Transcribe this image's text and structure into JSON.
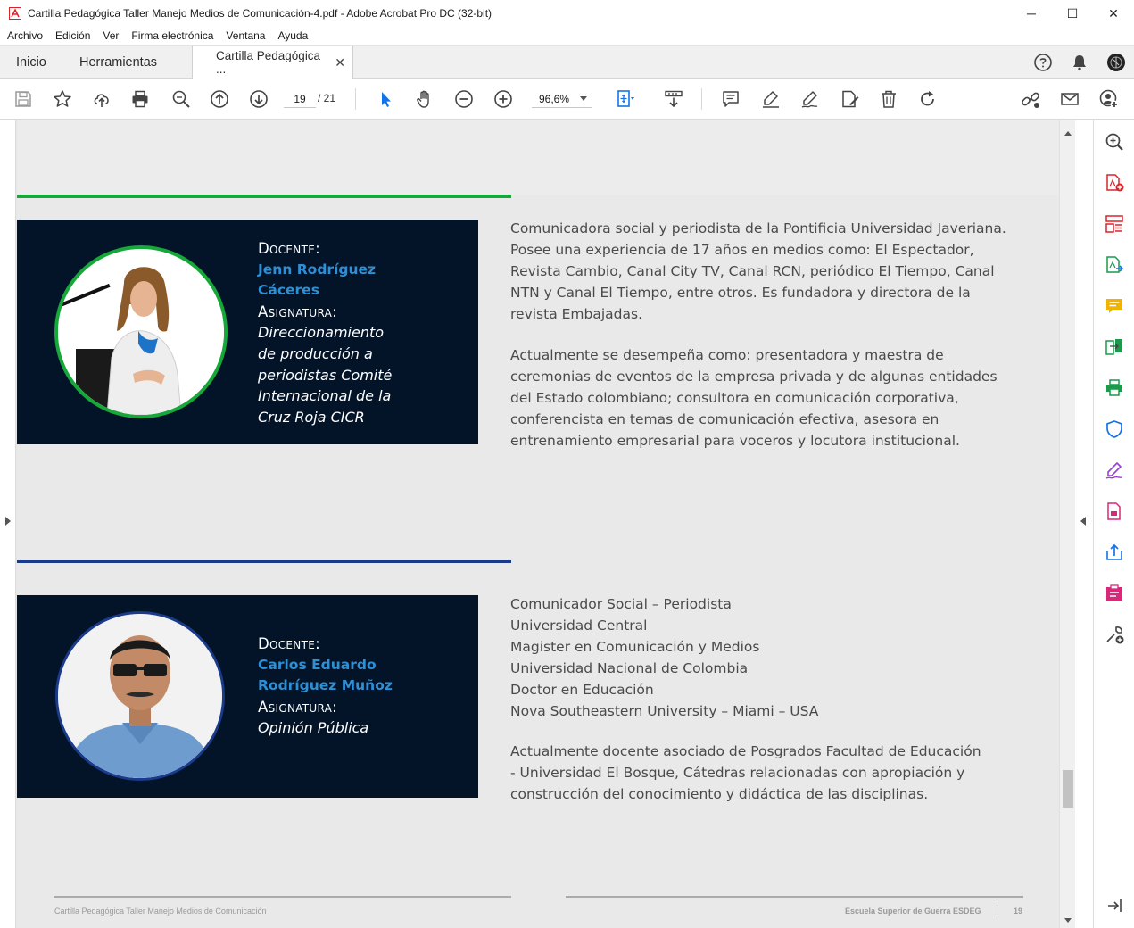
{
  "window": {
    "title": "Cartilla Pedagógica Taller Manejo Medios de Comunicación-4.pdf - Adobe Acrobat Pro DC (32-bit)",
    "controls": {
      "minimize": "─",
      "maximize": "☐",
      "close": "✕"
    }
  },
  "menu": [
    "Archivo",
    "Edición",
    "Ver",
    "Firma electrónica",
    "Ventana",
    "Ayuda"
  ],
  "tabs": [
    {
      "label": "Inicio"
    },
    {
      "label": "Herramientas"
    },
    {
      "label": "Cartilla Pedagógica ...",
      "close": "✕"
    }
  ],
  "toolbar": {
    "current_page": "19",
    "total_pages": "/ 21",
    "zoom": "96,6%"
  },
  "document": {
    "person1": {
      "docente_label": "Docente:",
      "name_line1": "Jenn Rodríguez",
      "name_line2": "Cáceres",
      "asignatura_label": "Asignatura:",
      "subject_lines": [
        "Direccionamiento",
        "de producción a",
        "periodistas Comité",
        "Internacional de la",
        "Cruz Roja CICR"
      ],
      "bio_p1": "Comunicadora social y periodista de la Pontificia Universidad Javeriana.\nPosee una experiencia de 17 años en medios como: El Espectador,\nRevista Cambio, Canal City TV, Canal RCN, periódico El Tiempo, Canal\nNTN y Canal El Tiempo, entre otros.  Es fundadora y directora de la\nrevista Embajadas.",
      "bio_p2": "Actualmente se desempeña como: presentadora y maestra de\nceremonias de eventos de la empresa privada y de algunas entidades\ndel Estado colombiano; consultora en comunicación corporativa,\nconferencista en temas de comunicación efectiva, asesora en\nentrenamiento empresarial para voceros y locutora  institucional."
    },
    "person2": {
      "docente_label": "Docente:",
      "name_line1": "Carlos Eduardo",
      "name_line2": "Rodríguez Muñoz",
      "asignatura_label": "Asignatura:",
      "subject_lines": [
        "Opinión Pública"
      ],
      "bio_p1": "Comunicador Social – Periodista\nUniversidad Central\nMagister en Comunicación y Medios\nUniversidad Nacional de Colombia\nDoctor en Educación\nNova Southeastern University – Miami – USA",
      "bio_p2": "Actualmente docente asociado de Posgrados Facultad de Educación\n- Universidad El Bosque, Cátedras relacionadas con apropiación y\nconstrucción del conocimiento y didáctica de las disciplinas."
    },
    "footer": {
      "left": "Cartilla Pedagógica Taller Manejo Medios de Comunicación",
      "right": "Escuela  Superior de Guerra ESDEG",
      "separator": "|",
      "page": "19"
    }
  },
  "colors": {
    "card_bg": "#031429",
    "name_blue": "#2e8fd4",
    "rule_green": "#16a838",
    "rule_blue": "#1a3a8a",
    "acrobat_red": "#d7252a",
    "tool_blue": "#1473e6"
  },
  "icons": {
    "toolbar": [
      "save-icon",
      "bookmark-star-icon",
      "upload-cloud-icon",
      "print-icon",
      "zoom-search-icon",
      "page-up-icon",
      "page-down-icon",
      "select-arrow-icon",
      "hand-icon",
      "zoom-out-icon",
      "zoom-in-icon",
      "fit-page-icon",
      "scroll-mode-icon",
      "comment-icon",
      "highlight-icon",
      "sign-pen-icon",
      "edit-redact-icon",
      "delete-icon",
      "rotate-icon",
      "share-link-icon",
      "email-icon",
      "add-user-icon"
    ],
    "right_pane": [
      "search-zoom-icon",
      "create-pdf-icon",
      "organize-pages-icon",
      "export-pdf-icon",
      "comment-icon",
      "compare-icon",
      "print-production-icon",
      "protect-shield-icon",
      "fill-sign-icon",
      "edit-pdf-icon",
      "share-icon",
      "redact-icon",
      "more-tools-icon",
      "collapse-pane-icon"
    ]
  }
}
